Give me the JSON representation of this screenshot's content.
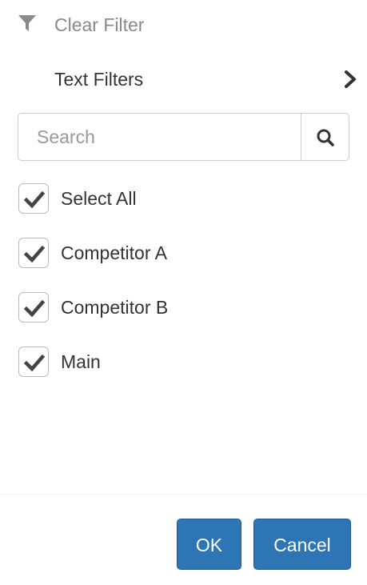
{
  "menu": {
    "clear_filter": {
      "label": "Clear Filter",
      "icon": "filter-icon",
      "enabled": false
    },
    "text_filters": {
      "label": "Text Filters",
      "icon": "chevron-right-icon",
      "has_submenu": true
    }
  },
  "search": {
    "placeholder": "Search",
    "value": "",
    "button_icon": "search-icon"
  },
  "checklist": {
    "items": [
      {
        "label": "Select All",
        "checked": true
      },
      {
        "label": "Competitor A",
        "checked": true
      },
      {
        "label": "Competitor B",
        "checked": true
      },
      {
        "label": "Main",
        "checked": true
      }
    ]
  },
  "footer": {
    "ok_label": "OK",
    "cancel_label": "Cancel"
  },
  "colors": {
    "primary_button": "#2e75b6",
    "disabled_text": "#8a8a8a",
    "text": "#333333",
    "border": "#cccccc"
  }
}
